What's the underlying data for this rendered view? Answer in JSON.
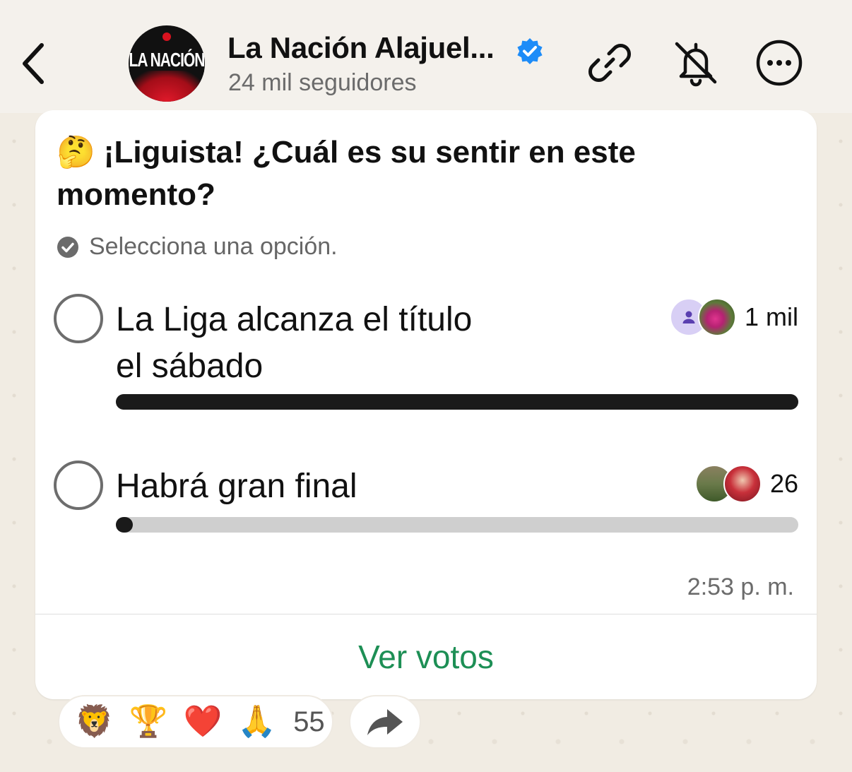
{
  "header": {
    "channel_name": "La Nación Alajuel...",
    "avatar_text": "LA NACIÓN",
    "followers": "24 mil seguidores",
    "back_icon": "chevron-left-icon",
    "link_icon": "link-icon",
    "mute_icon": "bell-off-icon",
    "more_icon": "more-circle-icon",
    "verified_color": "#1d8cf8"
  },
  "poll": {
    "question_emoji": "🤔",
    "question": "¡Liguista! ¿Cuál es su sentir en este momento?",
    "hint": "Selecciona una opción.",
    "options": [
      {
        "label_line1": "La Liga alcanza el título",
        "label_line2": "el sábado",
        "votes": "1 mil",
        "fill": 1.0
      },
      {
        "label_line1": "Habrá gran final",
        "label_line2": "",
        "votes": "26",
        "fill": 0.025
      }
    ],
    "timestamp": "2:53 p. m.",
    "view_votes": "Ver votos",
    "accent_color": "#1d8f55"
  },
  "reactions": {
    "emojis": [
      "🦁",
      "🏆",
      "❤️",
      "🙏"
    ],
    "count": "55",
    "forward_icon": "forward-arrow-icon"
  }
}
